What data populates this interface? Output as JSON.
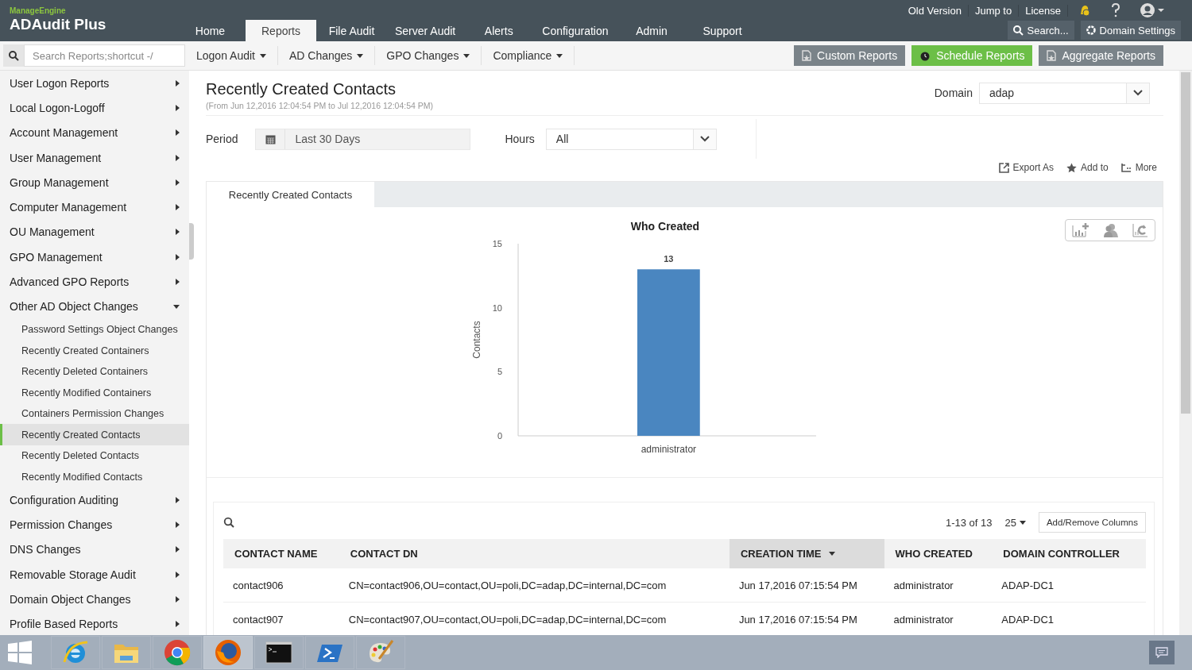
{
  "brand": {
    "vendor": "ManageEngine",
    "product": "ADAudit Plus"
  },
  "top_links": [
    "Old Version",
    "Jump to",
    "License"
  ],
  "nav_tabs": [
    {
      "label": "Home",
      "selected": false
    },
    {
      "label": "Reports",
      "selected": true
    },
    {
      "label": "File Audit",
      "selected": false
    },
    {
      "label": "Server Audit",
      "selected": false
    },
    {
      "label": "Alerts",
      "selected": false
    },
    {
      "label": "Configuration",
      "selected": false
    },
    {
      "label": "Admin",
      "selected": false
    },
    {
      "label": "Support",
      "selected": false
    }
  ],
  "header_search": {
    "label": "Search..."
  },
  "domain_settings": {
    "label": "Domain Settings"
  },
  "report_search": {
    "placeholder": "Search Reports;shortcut -/"
  },
  "menus": [
    "Logon Audit",
    "AD Changes",
    "GPO Changes",
    "Compliance"
  ],
  "action_buttons": [
    {
      "label": "Custom Reports",
      "kind": "custom"
    },
    {
      "label": "Schedule Reports",
      "kind": "schedule"
    },
    {
      "label": "Aggregate Reports",
      "kind": "aggregate"
    }
  ],
  "sidebar": {
    "items": [
      {
        "label": "User Logon Reports",
        "expanded": false
      },
      {
        "label": "Local Logon-Logoff",
        "expanded": false
      },
      {
        "label": "Account Management",
        "expanded": false
      },
      {
        "label": "User Management",
        "expanded": false
      },
      {
        "label": "Group Management",
        "expanded": false
      },
      {
        "label": "Computer Management",
        "expanded": false
      },
      {
        "label": "OU Management",
        "expanded": false
      },
      {
        "label": "GPO Management",
        "expanded": false
      },
      {
        "label": "Advanced GPO Reports",
        "expanded": false
      },
      {
        "label": "Other AD Object Changes",
        "expanded": true,
        "children": [
          {
            "label": "Password Settings Object Changes",
            "selected": false
          },
          {
            "label": "Recently Created Containers",
            "selected": false
          },
          {
            "label": "Recently Deleted Containers",
            "selected": false
          },
          {
            "label": "Recently Modified Containers",
            "selected": false
          },
          {
            "label": "Containers Permission Changes",
            "selected": false
          },
          {
            "label": "Recently Created Contacts",
            "selected": true
          },
          {
            "label": "Recently Deleted Contacts",
            "selected": false
          },
          {
            "label": "Recently Modified Contacts",
            "selected": false
          }
        ]
      },
      {
        "label": "Configuration Auditing",
        "expanded": false
      },
      {
        "label": "Permission Changes",
        "expanded": false
      },
      {
        "label": "DNS Changes",
        "expanded": false
      },
      {
        "label": "Removable Storage Audit",
        "expanded": false
      },
      {
        "label": "Domain Object Changes",
        "expanded": false
      },
      {
        "label": "Profile Based Reports",
        "expanded": false
      }
    ]
  },
  "report": {
    "title": "Recently Created Contacts",
    "range": "(From Jun 12,2016 12:04:54 PM to Jul 12,2016 12:04:54 PM)",
    "domain": {
      "label": "Domain",
      "value": "adap"
    },
    "period": {
      "label": "Period",
      "value": "Last 30 Days"
    },
    "hours": {
      "label": "Hours",
      "value": "All"
    },
    "tools": [
      {
        "label": "Export As",
        "kind": "export"
      },
      {
        "label": "Add to",
        "kind": "star"
      },
      {
        "label": "More",
        "kind": "more"
      }
    ],
    "tab": "Recently Created Contacts",
    "chart_data": {
      "type": "bar",
      "title": "Who Created",
      "ylabel": "Contacts",
      "categories": [
        "administrator"
      ],
      "values": [
        13
      ],
      "ylim": [
        0,
        15
      ],
      "yticks": [
        0,
        5,
        10,
        15
      ],
      "data_labels": true
    }
  },
  "table": {
    "pagination": "1-13 of 13",
    "page_size": "25",
    "columns_button": "Add/Remove Columns",
    "columns": [
      {
        "label": "CONTACT NAME",
        "sorted": false
      },
      {
        "label": "CONTACT DN",
        "sorted": false
      },
      {
        "label": "CREATION TIME",
        "sorted": true
      },
      {
        "label": "WHO CREATED",
        "sorted": false
      },
      {
        "label": "DOMAIN CONTROLLER",
        "sorted": false
      }
    ],
    "rows": [
      [
        "contact906",
        "CN=contact906,OU=contact,OU=poli,DC=adap,DC=internal,DC=com",
        "Jun 17,2016 07:15:54 PM",
        "administrator",
        "ADAP-DC1"
      ],
      [
        "contact907",
        "CN=contact907,OU=contact,OU=poli,DC=adap,DC=internal,DC=com",
        "Jun 17,2016 07:15:54 PM",
        "administrator",
        "ADAP-DC1"
      ]
    ]
  },
  "taskbar": {
    "apps": [
      {
        "kind": "ie",
        "selected": false
      },
      {
        "kind": "folder",
        "selected": false
      },
      {
        "kind": "chrome",
        "selected": false
      },
      {
        "kind": "firefox",
        "selected": true
      },
      {
        "kind": "terminal",
        "selected": false
      },
      {
        "kind": "shell",
        "selected": false
      },
      {
        "kind": "paint",
        "selected": false
      }
    ]
  }
}
